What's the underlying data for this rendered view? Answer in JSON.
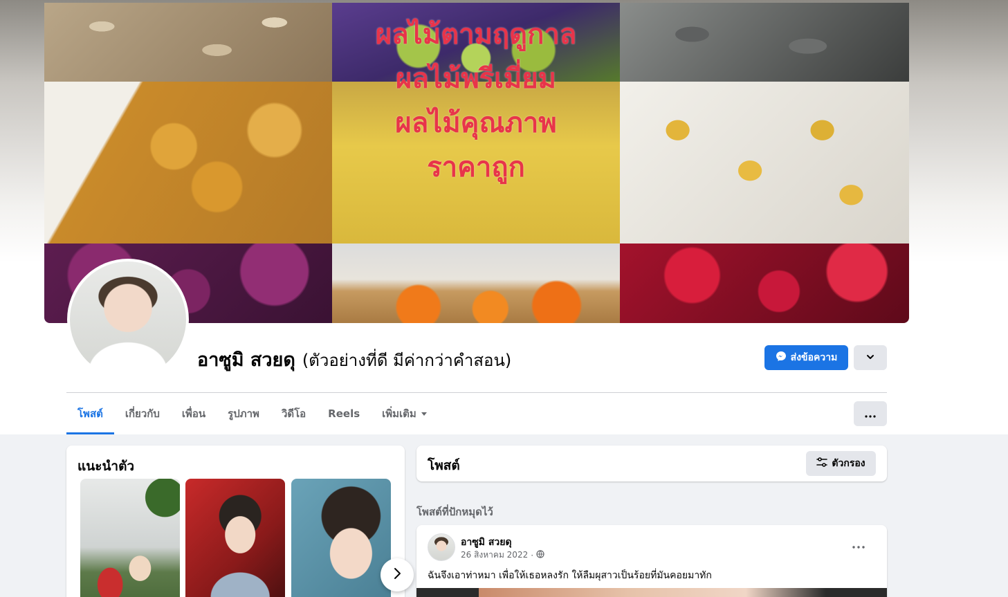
{
  "cover": {
    "text_lines": [
      "ผลไม้ตามฤดูกาล",
      "ผลไม้พรีเมี่ยม",
      "ผลไม้คุณภาพ",
      "ราคาถูก"
    ]
  },
  "profile": {
    "name": "อาซูมิ สวยดุ",
    "alternate_name": "(ตัวอย่างที่ดี มีค่ากว่าคำสอน)"
  },
  "actions": {
    "message_label": "ส่งข้อความ"
  },
  "tabs": [
    {
      "label": "โพสต์",
      "active": true
    },
    {
      "label": "เกี่ยวกับ"
    },
    {
      "label": "เพื่อน"
    },
    {
      "label": "รูปภาพ"
    },
    {
      "label": "วิดีโอ"
    },
    {
      "label": "Reels"
    },
    {
      "label": "เพิ่มเติม"
    }
  ],
  "intro": {
    "title": "แนะนำตัว"
  },
  "posts_section": {
    "title": "โพสต์",
    "filter_label": "ตัวกรอง",
    "pinned_label": "โพสต์ที่ปักหมุดไว้"
  },
  "post": {
    "author": "อาซูมิ สวยดุ",
    "date": "26 สิงหาคม 2022",
    "separator": "·",
    "text": "ฉันจึงเอาท่าหมา เพื่อให้เธอหลงรัก ให้ลืมผุสาวเป็นร้อยที่มันคอยมาทัก"
  },
  "colors": {
    "accent": "#1b74e4",
    "page_bg": "#f0f2f5",
    "secondary_button": "#e4e6eb",
    "cover_text": "#e8344a"
  }
}
